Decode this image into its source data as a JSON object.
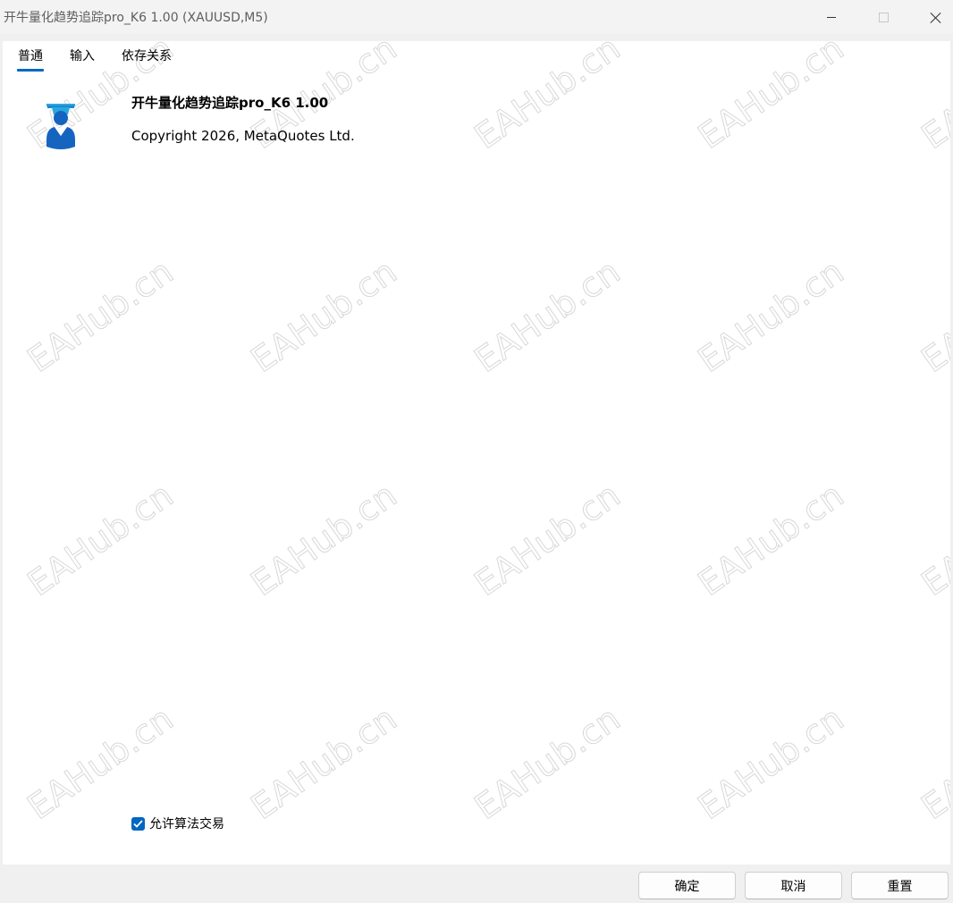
{
  "window": {
    "title": "开牛量化趋势追踪pro_K6 1.00 (XAUUSD,M5)"
  },
  "tabs": [
    {
      "label": "普通",
      "active": true
    },
    {
      "label": "输入",
      "active": false
    },
    {
      "label": "依存关系",
      "active": false
    }
  ],
  "header": {
    "icon": "expert-advisor-icon",
    "name": "开牛量化趋势追踪pro_K6 1.00",
    "copyright": "Copyright 2026, MetaQuotes Ltd."
  },
  "options": {
    "algo_trading_label": "允许算法交易",
    "algo_trading_checked": true
  },
  "buttons": {
    "ok": "确定",
    "cancel": "取消",
    "reset": "重置"
  },
  "watermark": {
    "text": "EAHub.cn"
  },
  "colors": {
    "accent": "#0067c0",
    "icon_blue": "#1565c0",
    "icon_light_blue": "#29a8e0"
  }
}
